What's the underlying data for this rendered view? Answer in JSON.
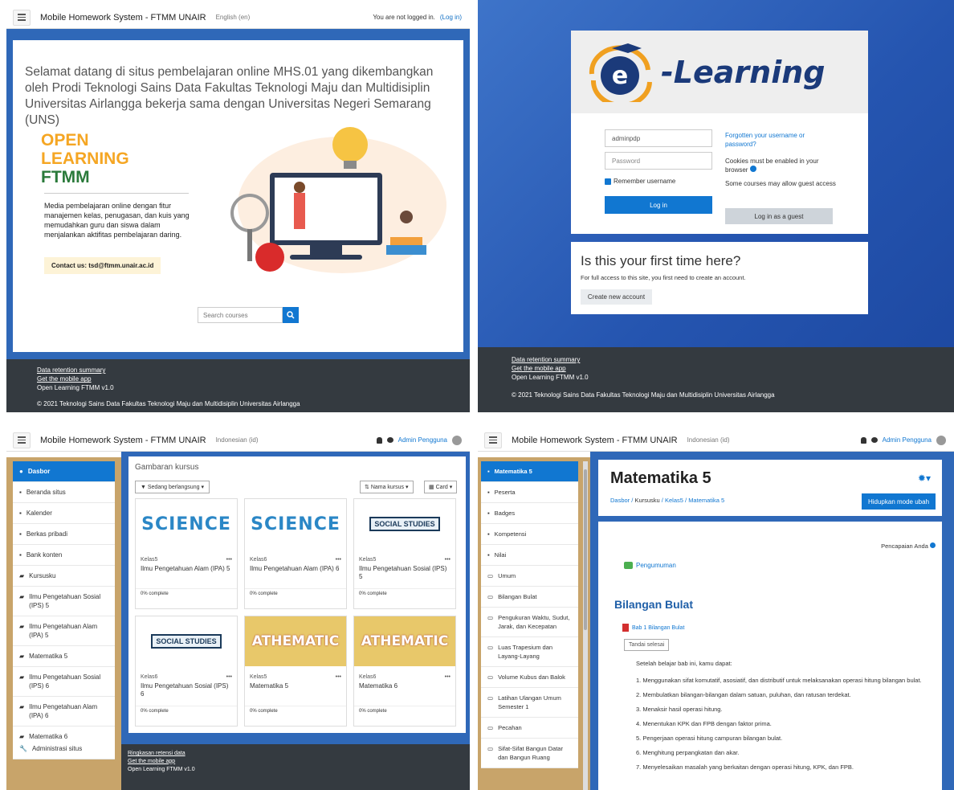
{
  "colors": {
    "primary": "#1177d1",
    "nav_blue": "#2f68b8",
    "sidebar_gold": "#c8a46a",
    "footer": "#343a40"
  },
  "q1": {
    "nav": {
      "title": "Mobile Homework System - FTMM UNAIR",
      "lang": "English (en)",
      "login_status": "You are not logged in.",
      "login_link": "(Log in)"
    },
    "welcome": "Selamat datang di situs pembelajaran online MHS.01 yang dikembangkan oleh Prodi Teknologi Sains Data Fakultas Teknologi Maju dan Multidisiplin Universitas Airlangga bekerja sama dengan Universitas Negeri Semarang (UNS)",
    "brand_l1": "OPEN",
    "brand_l2": "LEARNING",
    "brand_l3": "FTMM",
    "description": "Media pembelajaran online dengan fitur manajemen kelas, penugasan, dan kuis yang memudahkan guru dan siswa dalam menjalankan aktifitas pembelajaran daring.",
    "contact": "Contact us: tsd@ftmm.unair.ac.id",
    "search_placeholder": "Search courses",
    "footer": {
      "l1": "Data retention summary",
      "l2": "Get the mobile app",
      "l3": "Open Learning FTMM v1.0",
      "copy": "© 2021 Teknologi Sains Data Fakultas Teknologi Maju dan Multidisiplin Universitas Airlangga"
    }
  },
  "q2": {
    "logo": "-Learning",
    "username": "adminpdp",
    "password_placeholder": "Password",
    "remember": "Remember username",
    "login_btn": "Log in",
    "forgot": "Forgotten your username or password?",
    "cookies": "Cookies must be enabled in your browser",
    "guest_note": "Some courses may allow guest access",
    "guest_btn": "Log in as a guest",
    "first_title": "Is this your first time here?",
    "first_text": "For full access to this site, you first need to create an account.",
    "create_btn": "Create new account",
    "footer": {
      "l1": "Data retention summary",
      "l2": "Get the mobile app",
      "l3": "Open Learning FTMM v1.0",
      "copy": "© 2021 Teknologi Sains Data Fakultas Teknologi Maju dan Multidisiplin Universitas Airlangga"
    }
  },
  "q3": {
    "nav": {
      "title": "Mobile Homework System - FTMM UNAIR",
      "lang": "Indonesian (id)",
      "user": "Admin Pengguna"
    },
    "sidebar": [
      "Dasbor",
      "Beranda situs",
      "Kalender",
      "Berkas pribadi",
      "Bank konten",
      "Kursusku",
      "Ilmu Pengetahuan Sosial (IPS) 5",
      "Ilmu Pengetahuan Alam (IPA) 5",
      "Matematika 5",
      "Ilmu Pengetahuan Sosial (IPS) 6",
      "Ilmu Pengetahuan Alam (IPA) 6",
      "Matematika 6"
    ],
    "admin": "Administrasi situs",
    "heading": "Gambaran kursus",
    "filter": "Sedang berlangsung",
    "sort": "Nama kursus",
    "view": "Card",
    "courses": [
      {
        "cat": "Kelas5",
        "name": "Ilmu Pengetahuan Alam (IPA) 5",
        "progress": "0% complete",
        "img": "SCIENCE"
      },
      {
        "cat": "Kelas6",
        "name": "Ilmu Pengetahuan Alam (IPA) 6",
        "progress": "0% complete",
        "img": "SCIENCE"
      },
      {
        "cat": "Kelas5",
        "name": "Ilmu Pengetahuan Sosial (IPS) 5",
        "progress": "0% complete",
        "img": "SOCIAL STUDIES"
      },
      {
        "cat": "Kelas6",
        "name": "Ilmu Pengetahuan Sosial (IPS) 6",
        "progress": "0% complete",
        "img": "SOCIAL STUDIES"
      },
      {
        "cat": "Kelas5",
        "name": "Matematika 5",
        "progress": "0% complete",
        "img": "ATHEMATIC"
      },
      {
        "cat": "Kelas6",
        "name": "Matematika 6",
        "progress": "0% complete",
        "img": "ATHEMATIC"
      }
    ],
    "footer": {
      "l1": "Ringkasan retensi data",
      "l2": "Get the mobile app",
      "l3": "Open Learning FTMM v1.0"
    }
  },
  "q4": {
    "nav": {
      "title": "Mobile Homework System - FTMM UNAIR",
      "lang": "Indonesian (id)",
      "user": "Admin Pengguna"
    },
    "sidebar": [
      "Matematika 5",
      "Peserta",
      "Badges",
      "Kompetensi",
      "Nilai",
      "Umum",
      "Bilangan Bulat",
      "Pengukuran Waktu, Sudut, Jarak, dan Kecepatan",
      "Luas Trapesium dan Layang-Layang",
      "Volume Kubus dan Balok",
      "Latihan Ulangan Umum Semester 1",
      "Pecahan",
      "Sifat-Sifat Bangun Datar dan Bangun Ruang"
    ],
    "title": "Matematika 5",
    "breadcrumb": [
      "Dasbor",
      "Kursusku",
      "Kelas5",
      "Matematika 5"
    ],
    "edit_btn": "Hidupkan mode ubah",
    "achievement": "Pencapaian Anda",
    "announce": "Pengumuman",
    "section": "Bilangan Bulat",
    "file": "Bab 1 Bilangan Bulat",
    "mark_done": "Tandai selesai",
    "intro": "Setelah belajar bab ini, kamu dapat:",
    "objectives": [
      "1. Menggunakan sifat komutatif, asosiatif, dan distributif untuk melaksanakan operasi hitung bilangan bulat.",
      "2. Membulatkan bilangan-bilangan dalam satuan, puluhan, dan ratusan terdekat.",
      "3. Menaksir hasil operasi hitung.",
      "4. Menentukan KPK dan FPB dengan faktor prima.",
      "5. Pengerjaan operasi hitung campuran bilangan bulat.",
      "6. Menghitung perpangkatan dan akar.",
      "7. Menyelesaikan masalah yang berkaitan dengan operasi hitung, KPK, dan FPB."
    ]
  }
}
